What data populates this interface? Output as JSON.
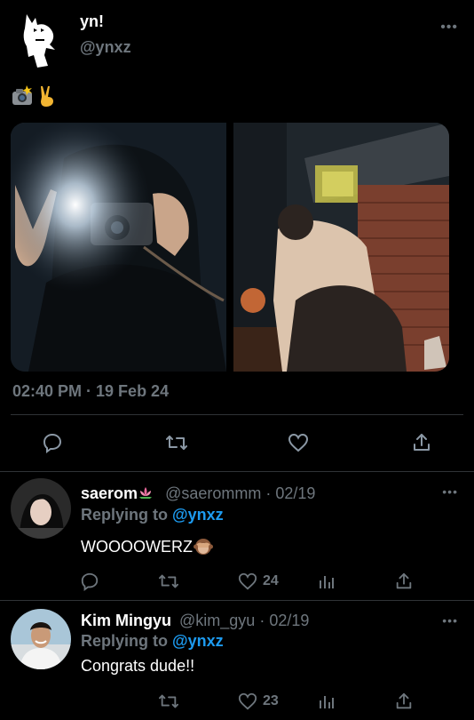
{
  "tweet": {
    "author_name": "yn!",
    "author_handle": "@ynxz",
    "text_emojis": [
      "camera-with-flash-emoji",
      "victory-hand-emoji"
    ],
    "timestamp": "02:40 PM · 19 Feb 24",
    "more": "•••",
    "media": [
      {
        "description": "photo-self-portrait-camera-flash"
      },
      {
        "description": "photo-couple-hug-brick-wall"
      }
    ]
  },
  "replies": [
    {
      "author_name": "saerom",
      "name_emoji": "lotus-emoji",
      "author_handle": "@saerommm",
      "date": "02/19",
      "replying_label": "Replying to",
      "replying_handle": "@ynxz",
      "text": "WOOOOWERZ",
      "text_emoji": "see-no-evil-monkey-emoji",
      "like_count": "24",
      "more": "•••"
    },
    {
      "author_name": "Kim Mingyu",
      "author_handle": "@kim_gyu",
      "date": "02/19",
      "replying_label": "Replying to",
      "replying_handle": "@ynxz",
      "text": "Congrats dude!!",
      "like_count": "23",
      "more": "•••"
    }
  ],
  "colors": {
    "background": "#000000",
    "text": "#ffffff",
    "muted": "#6e767d",
    "link": "#1d9bf0",
    "divider": "#2f3336"
  },
  "separator": " · "
}
